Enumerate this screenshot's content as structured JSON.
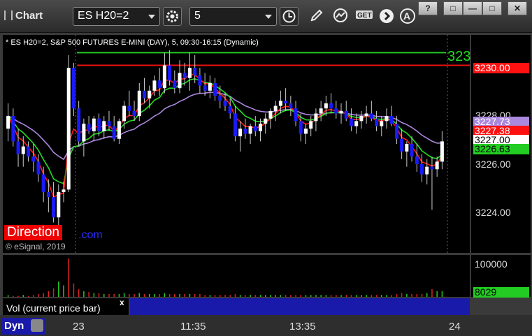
{
  "window": {
    "title": "Chart",
    "symbol": "ES H20=2",
    "interval": "5",
    "win_buttons": [
      "?",
      "□",
      "—",
      "□",
      "✕"
    ]
  },
  "chart": {
    "header_text": "* ES H20=2, S&P 500 FUTURES E-MINI (DAY), 5, 09:30-16:15 (Dynamic)",
    "copyright": "© eSignal, 2019",
    "direction_label": "Direction",
    "direction_suffix": ".com",
    "edge_label": "323",
    "colors": {
      "up": "#ffffff",
      "down": "#1a1aff",
      "ma_red": "#ff1a1a",
      "ma_green": "#22dd22",
      "ma_purple": "#aa88dd",
      "level_green": "#22cc22",
      "level_red": "#ee1111"
    }
  },
  "price_axis": {
    "ticks": [
      "3228.00",
      "3226.00",
      "3224.00"
    ],
    "labels": [
      {
        "text": "3230.00",
        "bg": "#ff1111",
        "fg": "#ffffff"
      },
      {
        "text": "3227.73",
        "bg": "#aa88dd",
        "fg": "#ffffff"
      },
      {
        "text": "3227.38",
        "bg": "#ff1111",
        "fg": "#ffffff"
      },
      {
        "text": "3227.00",
        "bg": "#ffffff",
        "fg": "#000000"
      },
      {
        "text": "3226.63",
        "bg": "#22cc22",
        "fg": "#000000"
      }
    ]
  },
  "volume": {
    "tick": "100000",
    "last_label": "8029",
    "indicator_label": "Vol (current price bar)",
    "close_mark": "x"
  },
  "time_axis": {
    "labels": [
      "23",
      "11:35",
      "13:35",
      "24"
    ],
    "dyn_label": "Dyn"
  },
  "chart_data": {
    "type": "candlestick",
    "y_axis_ticks": [
      3224,
      3226,
      3228
    ],
    "ylim": [
      3222.6,
      3231.2
    ],
    "levels": [
      3230.5,
      3230.0
    ],
    "candles": [
      [
        3227.5,
        3228.5,
        3227.0,
        3228.0
      ],
      [
        3228.0,
        3228.3,
        3226.8,
        3227.0
      ],
      [
        3227.0,
        3227.5,
        3226.0,
        3226.5
      ],
      [
        3226.5,
        3227.2,
        3226.0,
        3226.8
      ],
      [
        3226.8,
        3227.0,
        3226.2,
        3226.4
      ],
      [
        3226.4,
        3226.9,
        3225.8,
        3226.2
      ],
      [
        3226.2,
        3226.5,
        3225.4,
        3225.7
      ],
      [
        3225.7,
        3226.0,
        3224.6,
        3225.0
      ],
      [
        3225.0,
        3225.5,
        3224.2,
        3224.8
      ],
      [
        3224.8,
        3225.4,
        3223.8,
        3224.0
      ],
      [
        3224.0,
        3225.3,
        3223.3,
        3225.0
      ],
      [
        3225.0,
        3225.4,
        3224.6,
        3225.1
      ],
      [
        3225.1,
        3230.4,
        3225.0,
        3229.9
      ],
      [
        3229.9,
        3230.1,
        3228.0,
        3228.3
      ],
      [
        3228.3,
        3228.6,
        3226.8,
        3227.0
      ],
      [
        3227.0,
        3227.9,
        3226.4,
        3227.7
      ],
      [
        3227.7,
        3228.0,
        3227.3,
        3227.4
      ],
      [
        3227.4,
        3228.0,
        3227.0,
        3227.9
      ],
      [
        3227.9,
        3228.1,
        3227.2,
        3227.4
      ],
      [
        3227.4,
        3228.0,
        3227.1,
        3227.8
      ],
      [
        3227.8,
        3228.2,
        3227.4,
        3227.6
      ],
      [
        3227.6,
        3228.0,
        3227.0,
        3227.1
      ],
      [
        3227.1,
        3227.9,
        3226.9,
        3227.8
      ],
      [
        3227.8,
        3228.6,
        3227.5,
        3228.4
      ],
      [
        3228.4,
        3229.0,
        3228.0,
        3228.2
      ],
      [
        3228.2,
        3228.6,
        3227.8,
        3228.0
      ],
      [
        3228.0,
        3229.3,
        3227.8,
        3229.0
      ],
      [
        3229.0,
        3229.5,
        3228.5,
        3228.7
      ],
      [
        3228.7,
        3229.2,
        3228.3,
        3229.0
      ],
      [
        3229.0,
        3229.6,
        3228.8,
        3229.4
      ],
      [
        3229.4,
        3229.9,
        3228.8,
        3229.1
      ],
      [
        3229.1,
        3230.5,
        3228.9,
        3230.0
      ],
      [
        3230.0,
        3230.6,
        3229.2,
        3229.4
      ],
      [
        3229.4,
        3229.8,
        3228.9,
        3229.1
      ],
      [
        3229.1,
        3230.2,
        3228.9,
        3229.7
      ],
      [
        3229.7,
        3230.1,
        3229.2,
        3229.5
      ],
      [
        3229.5,
        3230.5,
        3229.0,
        3229.9
      ],
      [
        3229.9,
        3230.4,
        3229.3,
        3229.6
      ],
      [
        3229.6,
        3229.9,
        3228.9,
        3229.2
      ],
      [
        3229.2,
        3229.7,
        3228.8,
        3229.0
      ],
      [
        3229.0,
        3229.6,
        3228.7,
        3229.3
      ],
      [
        3229.3,
        3229.5,
        3228.6,
        3228.8
      ],
      [
        3228.8,
        3229.2,
        3228.3,
        3228.6
      ],
      [
        3228.6,
        3228.9,
        3228.2,
        3228.4
      ],
      [
        3228.4,
        3228.7,
        3227.9,
        3228.1
      ],
      [
        3228.1,
        3228.4,
        3227.0,
        3227.2
      ],
      [
        3227.2,
        3227.8,
        3226.6,
        3227.5
      ],
      [
        3227.5,
        3227.9,
        3227.1,
        3227.3
      ],
      [
        3227.3,
        3227.7,
        3226.9,
        3227.6
      ],
      [
        3227.6,
        3228.0,
        3227.2,
        3227.4
      ],
      [
        3227.4,
        3227.9,
        3227.0,
        3227.7
      ],
      [
        3227.7,
        3228.1,
        3227.3,
        3227.9
      ],
      [
        3227.9,
        3228.3,
        3227.5,
        3228.2
      ],
      [
        3228.2,
        3228.6,
        3227.8,
        3228.4
      ],
      [
        3228.4,
        3229.0,
        3228.1,
        3228.6
      ],
      [
        3228.6,
        3229.1,
        3228.2,
        3228.5
      ],
      [
        3228.5,
        3228.8,
        3228.0,
        3228.3
      ],
      [
        3228.3,
        3228.6,
        3227.6,
        3227.8
      ],
      [
        3227.8,
        3228.1,
        3227.0,
        3227.3
      ],
      [
        3227.3,
        3227.7,
        3226.9,
        3227.5
      ],
      [
        3227.5,
        3228.0,
        3227.2,
        3227.8
      ],
      [
        3227.8,
        3228.3,
        3227.4,
        3228.1
      ],
      [
        3228.1,
        3228.6,
        3227.8,
        3228.3
      ],
      [
        3228.3,
        3228.8,
        3228.0,
        3228.5
      ],
      [
        3228.5,
        3228.9,
        3228.1,
        3228.3
      ],
      [
        3228.3,
        3228.6,
        3227.9,
        3228.1
      ],
      [
        3228.1,
        3228.5,
        3227.7,
        3228.2
      ],
      [
        3228.2,
        3228.6,
        3227.8,
        3227.9
      ],
      [
        3227.9,
        3228.3,
        3227.4,
        3227.6
      ],
      [
        3227.6,
        3228.1,
        3227.3,
        3227.8
      ],
      [
        3227.8,
        3228.2,
        3227.5,
        3228.0
      ],
      [
        3228.0,
        3228.4,
        3227.7,
        3228.1
      ],
      [
        3228.1,
        3228.6,
        3227.8,
        3227.9
      ],
      [
        3227.9,
        3228.2,
        3227.4,
        3227.6
      ],
      [
        3227.6,
        3228.0,
        3227.2,
        3227.8
      ],
      [
        3227.8,
        3228.3,
        3227.5,
        3228.0
      ],
      [
        3228.0,
        3228.4,
        3227.6,
        3227.7
      ],
      [
        3227.7,
        3228.0,
        3226.9,
        3227.1
      ],
      [
        3227.1,
        3227.5,
        3226.3,
        3226.6
      ],
      [
        3226.6,
        3227.0,
        3226.0,
        3226.9
      ],
      [
        3226.9,
        3227.2,
        3226.2,
        3226.4
      ],
      [
        3226.4,
        3226.9,
        3225.8,
        3226.1
      ],
      [
        3226.1,
        3226.5,
        3225.4,
        3225.7
      ],
      [
        3225.7,
        3226.3,
        3225.3,
        3226.0
      ],
      [
        3226.0,
        3226.4,
        3224.3,
        3225.9
      ],
      [
        3225.9,
        3226.4,
        3225.6,
        3226.2
      ],
      [
        3226.2,
        3227.4,
        3225.9,
        3227.0
      ]
    ],
    "volume": [
      2,
      1,
      1,
      2,
      1,
      2,
      3,
      4,
      6,
      9,
      16,
      12,
      40,
      14,
      8,
      6,
      5,
      4,
      4,
      3,
      3,
      3,
      3,
      4,
      3,
      3,
      4,
      3,
      3,
      3,
      3,
      4,
      3,
      3,
      3,
      3,
      3,
      3,
      3,
      2,
      2,
      2,
      2,
      2,
      2,
      3,
      2,
      2,
      2,
      2,
      2,
      2,
      2,
      2,
      2,
      2,
      2,
      2,
      2,
      2,
      2,
      2,
      2,
      2,
      2,
      2,
      2,
      2,
      2,
      2,
      2,
      2,
      2,
      2,
      2,
      2,
      2,
      3,
      4,
      3,
      3,
      3,
      3,
      4,
      8,
      6,
      6
    ]
  }
}
